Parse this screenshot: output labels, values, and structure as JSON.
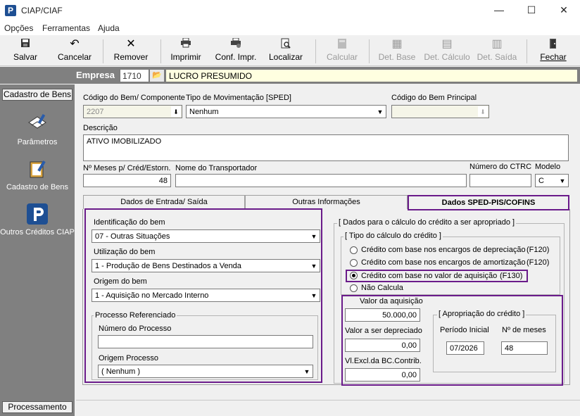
{
  "window": {
    "title": "CIAP/CIAF",
    "min": "—",
    "max": "☐",
    "close": "✕"
  },
  "menu": [
    "Opções",
    "Ferramentas",
    "Ajuda"
  ],
  "toolbar": {
    "salvar": "Salvar",
    "cancelar": "Cancelar",
    "remover": "Remover",
    "imprimir": "Imprimir",
    "conf_impr": "Conf. Impr.",
    "localizar": "Localizar",
    "calcular": "Calcular",
    "det_base": "Det. Base",
    "det_calculo": "Det. Cálculo",
    "det_saida": "Det. Saída",
    "fechar": "Fechar"
  },
  "empresa": {
    "label": "Empresa",
    "code": "1710",
    "name": "LUCRO PRESUMIDO"
  },
  "sidebar": {
    "header": "Cadastro de Bens",
    "items": [
      "Parâmetros",
      "Cadastro de Bens",
      "Outros Créditos CIAP"
    ],
    "footer": "Processamento"
  },
  "form": {
    "codigo_bem_label": "Código do Bem/ Componente",
    "codigo_bem": "2207",
    "tipo_mov_label": "Tipo de Movimentação [SPED]",
    "tipo_mov": "Nenhum",
    "codigo_principal_label": "Código do Bem Principal",
    "codigo_principal": "",
    "descricao_label": "Descrição",
    "descricao": "ATIVO IMOBILIZADO",
    "meses_label": "Nº Meses p/ Créd/Estorn.",
    "meses": "48",
    "transportador_label": "Nome do Transportador",
    "transportador": "",
    "ctrc_label": "Número do CTRC",
    "ctrc": "",
    "modelo_label": "Modelo",
    "modelo": "C"
  },
  "tabs": [
    "Dados de Entrada/ Saída",
    "Outras Informações",
    "Dados SPED-PIS/COFINS"
  ],
  "left": {
    "identificacao_label": "Identificação do bem",
    "identificacao": "07 - Outras Situações",
    "utilizacao_label": "Utilização do bem",
    "utilizacao": "1 - Produção de Bens Destinados a Venda",
    "origem_label": "Origem do bem",
    "origem": "1 - Aquisição no Mercado Interno",
    "processo_group": "Processo Referenciado",
    "numero_processo_label": "Número do Processo",
    "numero_processo": "",
    "origem_processo_label": "Origem Processo",
    "origem_processo": "( Nenhum )"
  },
  "right": {
    "group_title": "[ Dados para o cálculo do crédito a ser apropriado ]",
    "tipo_title": "[ Tipo do cálculo do crédito ]",
    "options": [
      {
        "label": "Crédito com base nos encargos de depreciação",
        "code": "(F120)"
      },
      {
        "label": "Crédito com base nos encargos de amortização",
        "code": "(F120)"
      },
      {
        "label": "Crédito com base no valor de aquisição",
        "code": "(F130)"
      },
      {
        "label": "Não Calcula",
        "code": ""
      }
    ],
    "selected_option": 2,
    "valor_aquisicao_label": "Valor da aquisição",
    "valor_aquisicao": "50.000,00",
    "valor_depreciado_label": "Valor a ser depreciado",
    "valor_depreciado": "0,00",
    "vl_excl_label": "Vl.Excl.da BC.Contrib.",
    "vl_excl": "0,00",
    "apropriacao_title": "[ Apropriação do crédito ]",
    "periodo_label": "Período Inicial",
    "periodo": "07/2026",
    "n_meses_label": "Nº de meses",
    "n_meses": "48"
  }
}
